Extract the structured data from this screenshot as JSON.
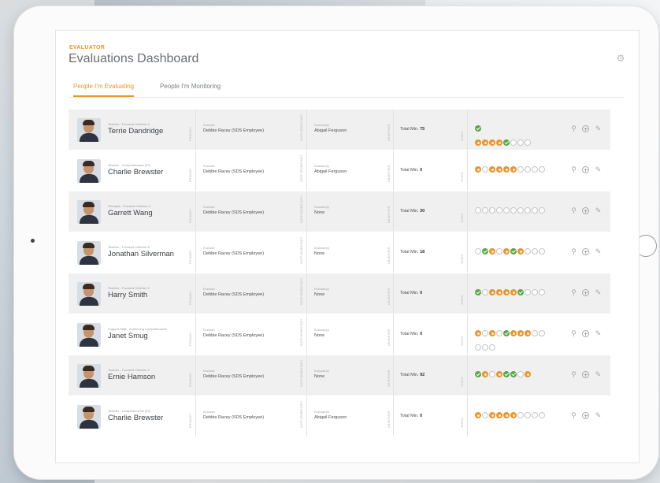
{
  "header": {
    "eyebrow": "EVALUATOR",
    "title": "Evaluations Dashboard"
  },
  "tabs": [
    {
      "label": "People I'm Evaluating",
      "active": true
    },
    {
      "label": "People I'm Monitoring",
      "active": false
    }
  ],
  "colors": {
    "accent": "#e8962e",
    "success": "#5ba64a"
  },
  "icons": {
    "settings": "gear-icon",
    "search": "search-icon",
    "add": "plus-circle-icon",
    "edit": "edit-icon"
  },
  "rows": [
    {
      "role": "Teacher - Focused Criterion 4",
      "name": "Terrie Dandridge",
      "evaluator_label": "Evaluator",
      "evaluator": "Debbie Racey (SDS Employee)",
      "evaluatees_label": "Evaluator(s)",
      "evaluatees": "Abigail Ferguson",
      "total_label": "Total Min.",
      "total": "75",
      "circles": [
        [
          "green"
        ],
        [
          "orange",
          "orange",
          "orange",
          "orange",
          "green",
          "empty",
          "empty",
          "empty"
        ]
      ]
    },
    {
      "role": "Teacher - Comprehensive (P2)",
      "name": "Charlie Brewster",
      "evaluator_label": "Evaluator",
      "evaluator": "Debbie Racey (SDS Employee)",
      "evaluatees_label": "Evaluator(s)",
      "evaluatees": "Abigail Ferguson",
      "total_label": "Total Min.",
      "total": "0",
      "circles": [
        [
          "orange",
          "empty",
          "orange",
          "orange",
          "orange",
          "orange",
          "empty",
          "empty",
          "empty",
          "empty"
        ]
      ]
    },
    {
      "role": "Principal - Focused Criterion 3",
      "name": "Garrett Wang",
      "evaluator_label": "Evaluator",
      "evaluator": "Debbie Racey (SDS Employee)",
      "evaluatees_label": "Evaluator(s)",
      "evaluatees": "None",
      "total_label": "Total Min.",
      "total": "30",
      "circles": [
        [
          "empty",
          "empty",
          "empty",
          "empty",
          "empty",
          "empty",
          "empty",
          "empty",
          "empty",
          "empty"
        ]
      ]
    },
    {
      "role": "Teacher - Focused Criterion 6",
      "name": "Jonathan Silverman",
      "evaluator_label": "Evaluator",
      "evaluator": "Debbie Racey (SDS Employee)",
      "evaluatees_label": "Evaluator(s)",
      "evaluatees": "None",
      "total_label": "Total Min.",
      "total": "18",
      "circles": [
        [
          "empty",
          "green",
          "orange",
          "empty",
          "orange",
          "green",
          "orange",
          "empty",
          "empty",
          "empty"
        ]
      ]
    },
    {
      "role": "Teacher - Focused Criterion 2",
      "name": "Harry Smith",
      "evaluator_label": "Evaluator",
      "evaluator": "Debbie Racey (SDS Employee)",
      "evaluatees_label": "Evaluator(s)",
      "evaluatees": "None",
      "total_label": "Total Min.",
      "total": "0",
      "circles": [
        [
          "green",
          "empty",
          "orange",
          "orange",
          "orange",
          "orange",
          "green",
          "empty",
          "empty",
          "empty"
        ]
      ]
    },
    {
      "role": "Support Staff - Continuing Comprehensive",
      "name": "Janet Smug",
      "evaluator_label": "Evaluator",
      "evaluator": "Debbie Racey (SDS Employee)",
      "evaluatees_label": "Evaluator(s)",
      "evaluatees": "None",
      "total_label": "Total Min.",
      "total": "0",
      "circles": [
        [
          "orange",
          "empty",
          "orange",
          "empty",
          "green",
          "orange",
          "orange",
          "orange",
          "empty",
          "empty"
        ],
        [
          "empty",
          "empty",
          "empty"
        ]
      ]
    },
    {
      "role": "Teacher - Focused Criterion 4",
      "name": "Ernie Hamson",
      "evaluator_label": "Evaluator",
      "evaluator": "Debbie Racey (SDS Employee)",
      "evaluatees_label": "Evaluator(s)",
      "evaluatees": "None",
      "total_label": "Total Min.",
      "total": "92",
      "circles": [
        [
          "green",
          "orange",
          "empty",
          "orange",
          "green",
          "green",
          "empty",
          "orange"
        ]
      ]
    },
    {
      "role": "Teacher - Comprehensive (P2)",
      "name": "Charlie Brewster",
      "evaluator_label": "Evaluator",
      "evaluator": "Debbie Racey (SDS Employee)",
      "evaluatees_label": "Evaluator(s)",
      "evaluatees": "Abigail Ferguson",
      "total_label": "Total Min.",
      "total": "0",
      "circles": [
        [
          "orange",
          "empty",
          "orange",
          "orange",
          "orange",
          "orange",
          "empty",
          "empty",
          "empty",
          "empty"
        ]
      ]
    }
  ],
  "column_labels": {
    "primary": "PRIMARY",
    "supplementary": "SUPPLEMENTARY",
    "observer": "OBSERVER",
    "tasks": "TASKS"
  }
}
